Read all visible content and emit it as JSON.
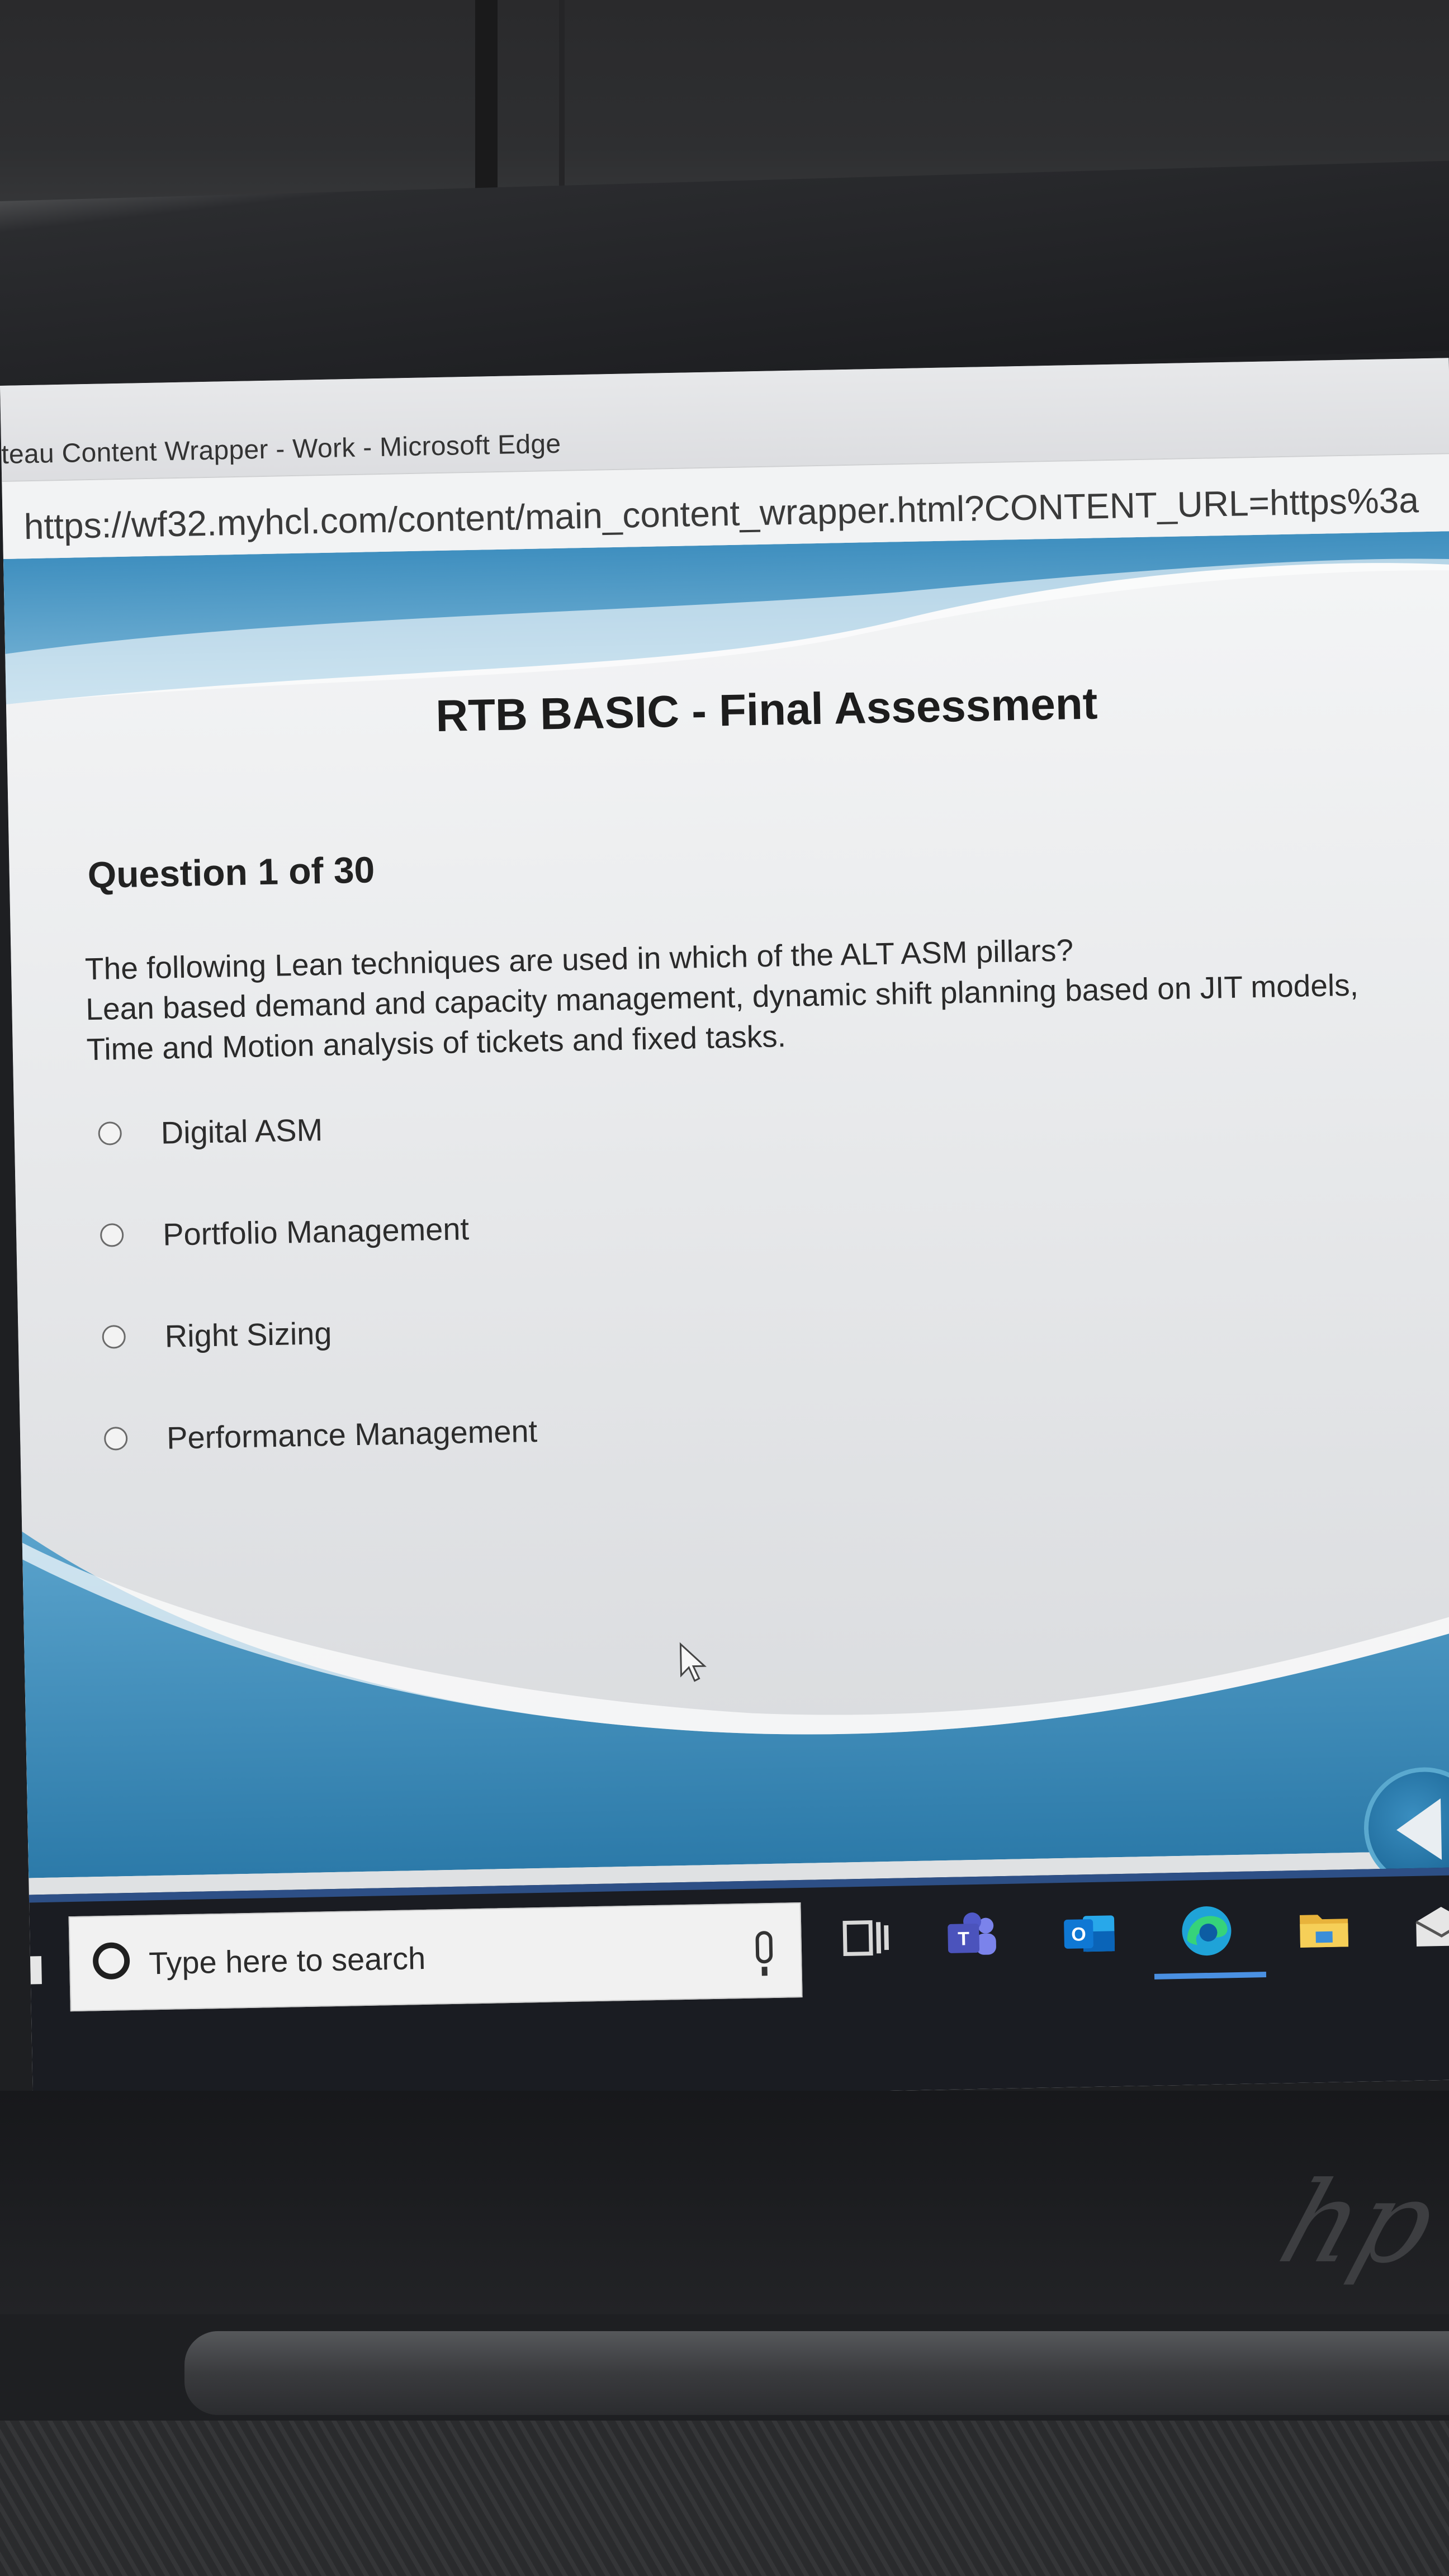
{
  "window": {
    "title": "teau Content Wrapper - Work - Microsoft Edge",
    "url": "https://wf32.myhcl.com/content/main_content_wrapper.html?CONTENT_URL=https%3a"
  },
  "course": {
    "title": "RTB BASIC - Final Assessment"
  },
  "question": {
    "counter": "Question 1 of 30",
    "lines": [
      "The following Lean techniques are used in which of the ALT ASM pillars?",
      "Lean based demand and capacity management, dynamic shift planning based on JIT models,",
      "Time and Motion analysis of tickets and fixed tasks."
    ],
    "options": [
      {
        "label": "Digital ASM",
        "selected": false
      },
      {
        "label": "Portfolio Management",
        "selected": false
      },
      {
        "label": "Right Sizing",
        "selected": false
      },
      {
        "label": "Performance Management",
        "selected": false
      }
    ]
  },
  "taskbar": {
    "search_placeholder": "Type here to search",
    "apps": [
      "task-view-icon",
      "teams-icon",
      "outlook-icon",
      "edge-icon",
      "file-explorer-icon",
      "mail-icon"
    ],
    "active_app": "edge-icon"
  },
  "colors": {
    "accent_blue": "#2f7fb5",
    "nav_button": "#1f6b9b",
    "taskbar": "#1a1c22"
  }
}
